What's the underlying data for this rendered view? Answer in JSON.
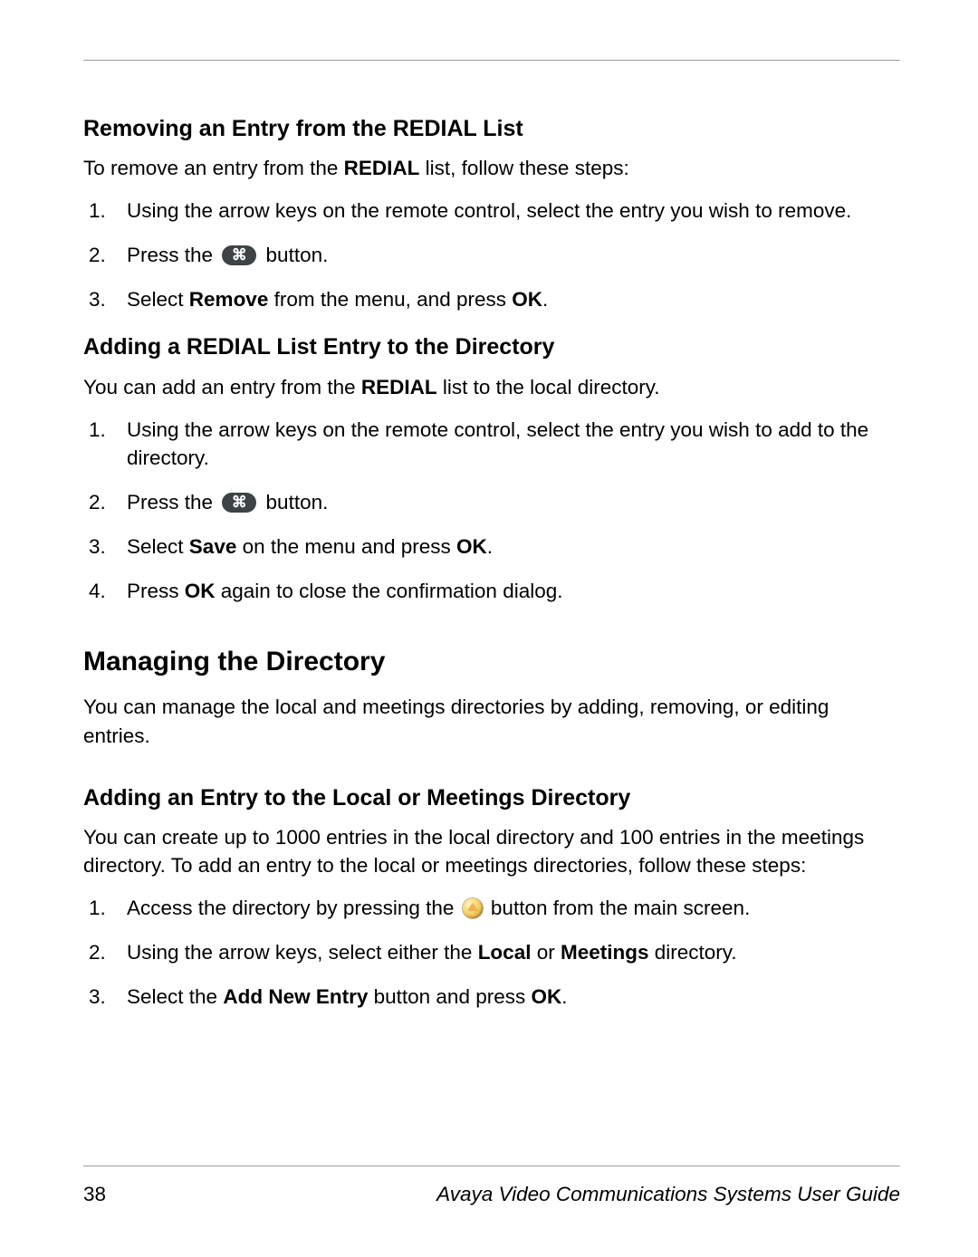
{
  "footer": {
    "page_number": "38",
    "doc_title": "Avaya Video Communications Systems User Guide"
  },
  "sections": {
    "removing": {
      "heading": "Removing an Entry from the REDIAL List",
      "intro_before_bold": "To remove an entry from the ",
      "intro_bold": "REDIAL",
      "intro_after_bold": " list, follow these steps:",
      "step1": "Using the arrow keys on the remote control, select the entry you wish to remove.",
      "step2_before": "Press the ",
      "step2_after": " button.",
      "step3_a": "Select ",
      "step3_b": "Remove",
      "step3_c": " from the menu, and press ",
      "step3_d": "OK",
      "step3_e": "."
    },
    "adding_redial": {
      "heading": "Adding a REDIAL List Entry to the Directory",
      "intro_before_bold": "You can add an entry from the ",
      "intro_bold": "REDIAL",
      "intro_after_bold": " list to the local directory.",
      "step1": "Using the arrow keys on the remote control, select the entry you wish to add to the directory.",
      "step2_before": "Press the ",
      "step2_after": " button.",
      "step3_a": "Select ",
      "step3_b": "Save",
      "step3_c": " on the menu and press ",
      "step3_d": "OK",
      "step3_e": ".",
      "step4_a": "Press ",
      "step4_b": "OK",
      "step4_c": " again to close the confirmation dialog."
    },
    "managing": {
      "heading": "Managing the Directory",
      "intro": "You can manage the local and meetings directories by adding, removing, or editing entries."
    },
    "adding_local": {
      "heading": "Adding an Entry to the Local or Meetings Directory",
      "intro": "You can create up to 1000 entries in the local directory and 100 entries in the meetings directory. To add an entry to the local or meetings directories, follow these steps:",
      "step1_before": "Access the directory by pressing the ",
      "step1_after": " button from the main screen.",
      "step2_a": "Using the arrow keys, select either the ",
      "step2_b": "Local",
      "step2_c": " or ",
      "step2_d": "Meetings",
      "step2_e": " directory.",
      "step3_a": "Select the ",
      "step3_b": "Add New Entry",
      "step3_c": " button and press ",
      "step3_d": "OK",
      "step3_e": "."
    }
  },
  "icons": {
    "command_glyph": "⌘"
  }
}
